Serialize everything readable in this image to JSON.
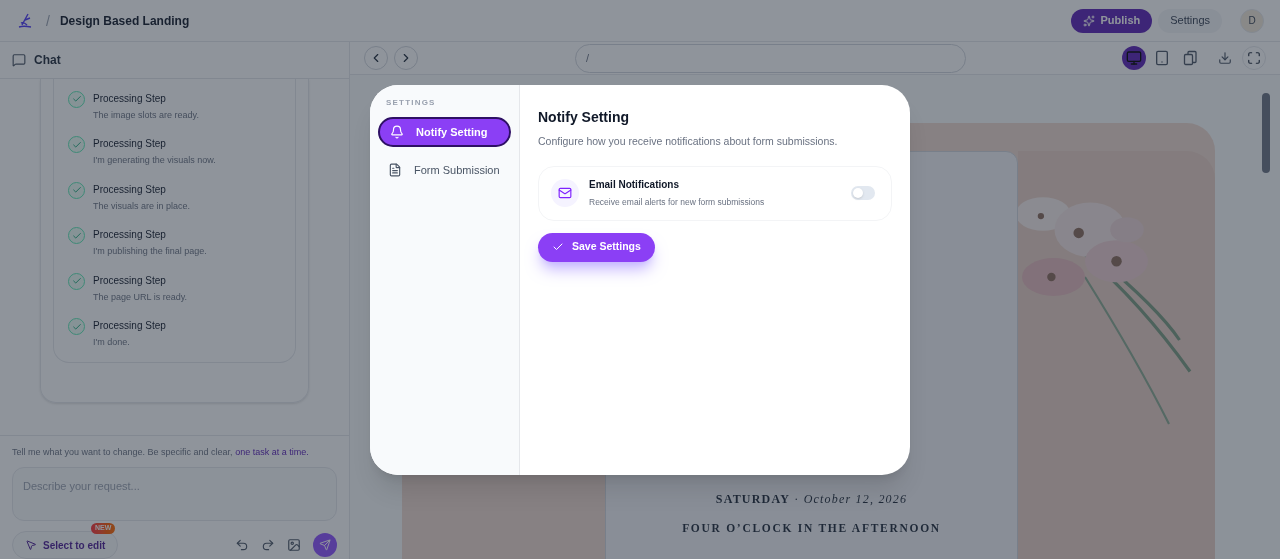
{
  "header": {
    "separator": "/",
    "title": "Design Based Landing",
    "publish": "Publish",
    "settings": "Settings",
    "avatar": "D"
  },
  "chat": {
    "title": "Chat",
    "steps": [
      {
        "title": "Processing Step",
        "detail": "The image slots are ready.",
        "done": true
      },
      {
        "title": "Processing Step",
        "detail": "I'm generating the visuals now.",
        "done": true
      },
      {
        "title": "Processing Step",
        "detail": "The visuals are in place.",
        "done": true
      },
      {
        "title": "Processing Step",
        "detail": "I'm publishing the final page.",
        "done": true
      },
      {
        "title": "Processing Step",
        "detail": "The page URL is ready.",
        "done": true
      },
      {
        "title": "Processing Step",
        "detail": "I'm done.",
        "done": true
      }
    ],
    "hint": "Tell me what you want to change. Be specific and clear,",
    "hint_link": "one task at a time.",
    "placeholder": "Describe your request...",
    "select_button": "Select to edit",
    "badge": "NEW"
  },
  "preview": {
    "url": "/",
    "devices": [
      {
        "kind": "desktop",
        "selected": true
      },
      {
        "kind": "tablet",
        "selected": false
      },
      {
        "kind": "responsive",
        "selected": false
      }
    ],
    "date_line": "**SATURDAY** · *October 12, 2026*",
    "time_line": "FOUR O’CLOCK IN THE AFTERNOON"
  },
  "modal": {
    "section_label": "SETTINGS",
    "nav": [
      {
        "label": "Notify Setting",
        "kind": "bell",
        "selected": true
      },
      {
        "label": "Form Submission",
        "kind": "file",
        "selected": false
      }
    ],
    "title": "Notify Setting",
    "subtitle": "Configure how you receive notifications about form submissions.",
    "options": [
      {
        "title": "Email Notifications",
        "detail": "Receive email alerts for new form submissions",
        "on": false
      }
    ],
    "save": "Save Settings"
  }
}
